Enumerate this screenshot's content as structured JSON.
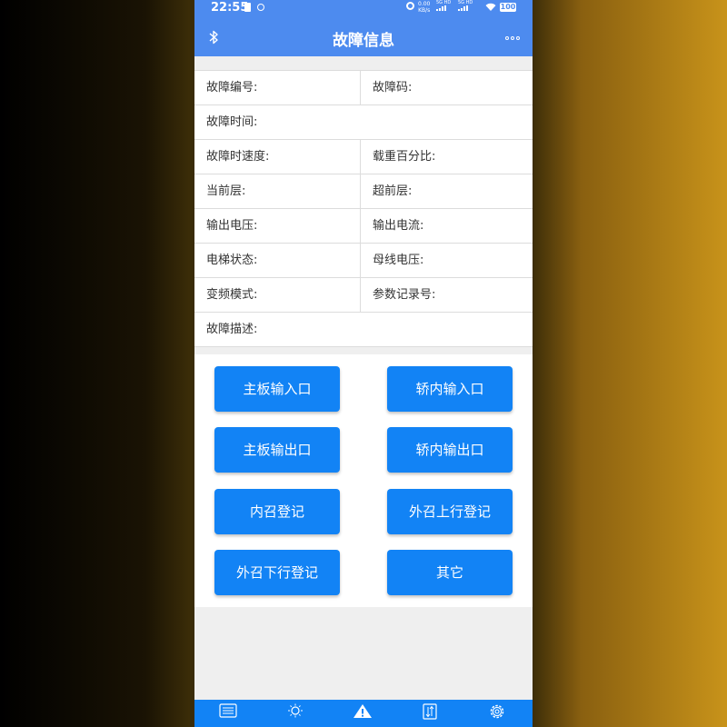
{
  "status_bar": {
    "time": "22:55",
    "net_speed": "0.00",
    "net_unit": "KB/s",
    "sig1_label": "5G HD",
    "sig2_label": "5G HD",
    "battery": "100"
  },
  "app_bar": {
    "title": "故障信息",
    "left_icon": "bluetooth-icon",
    "right_icon": "more-icon"
  },
  "info": {
    "fault_no": "故障编号:",
    "fault_code": "故障码:",
    "fault_time": "故障时间:",
    "fault_speed": "故障时速度:",
    "load_percent": "载重百分比:",
    "current_floor": "当前层:",
    "advance_floor": "超前层:",
    "output_voltage": "输出电压:",
    "output_current": "输出电流:",
    "elevator_status": "电梯状态:",
    "bus_voltage": "母线电压:",
    "vf_mode": "变频模式:",
    "param_record_no": "参数记录号:",
    "fault_desc": "故障描述:"
  },
  "buttons": {
    "main_board_input": "主板输入口",
    "car_input": "轿内输入口",
    "main_board_output": "主板输出口",
    "car_output": "轿内输出口",
    "inner_call": "内召登记",
    "outer_call_up": "外召上行登记",
    "outer_call_down": "外召下行登记",
    "other": "其它"
  },
  "bottom_nav": {
    "items": [
      {
        "icon": "sliders-icon"
      },
      {
        "icon": "sun-icon"
      },
      {
        "icon": "warning-icon"
      },
      {
        "icon": "transfer-icon"
      },
      {
        "icon": "gear-icon"
      }
    ]
  },
  "colors": {
    "app_bar": "#4d8bef",
    "button": "#1283f5",
    "nav": "#1283f5"
  }
}
